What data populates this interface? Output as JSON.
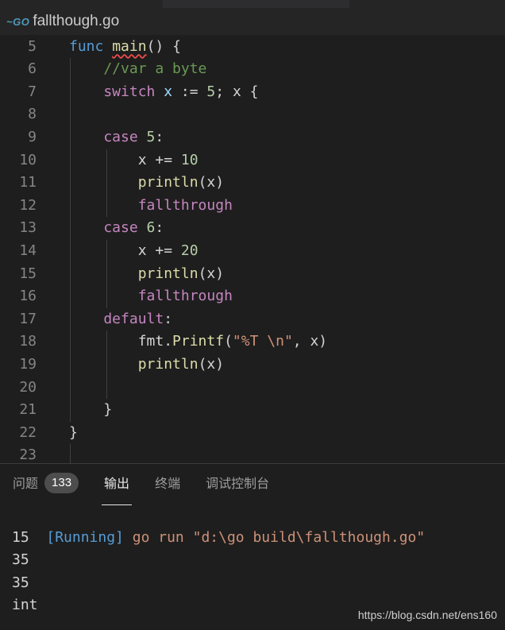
{
  "tab": {
    "icon": "go-file-icon",
    "icon_text": "~GO",
    "file_name": "fallthough.go"
  },
  "editor": {
    "lines": [
      {
        "n": "5",
        "t": [
          [
            "kw",
            "func"
          ],
          [
            "",
            ""
          ],
          [
            "fn sq",
            "main"
          ],
          [
            "",
            "() {"
          ]
        ]
      },
      {
        "n": "6",
        "t": [
          [
            "cm",
            "    //var a byte"
          ]
        ]
      },
      {
        "n": "7",
        "t": [
          [
            "ctl",
            "    switch"
          ],
          [
            "var",
            " x"
          ],
          [
            "",
            " := "
          ],
          [
            "num",
            "5"
          ],
          [
            "",
            "; x {"
          ]
        ]
      },
      {
        "n": "8",
        "t": []
      },
      {
        "n": "9",
        "t": [
          [
            "ctl",
            "    case"
          ],
          [
            "num",
            " 5"
          ],
          [
            "",
            ":"
          ]
        ]
      },
      {
        "n": "10",
        "t": [
          [
            "",
            "        x += "
          ],
          [
            "num",
            "10"
          ]
        ]
      },
      {
        "n": "11",
        "t": [
          [
            "fn",
            "        println"
          ],
          [
            "",
            "(x)"
          ]
        ]
      },
      {
        "n": "12",
        "t": [
          [
            "ctl",
            "        fallthrough"
          ]
        ]
      },
      {
        "n": "13",
        "t": [
          [
            "ctl",
            "    case"
          ],
          [
            "num",
            " 6"
          ],
          [
            "",
            ":"
          ]
        ]
      },
      {
        "n": "14",
        "t": [
          [
            "",
            "        x += "
          ],
          [
            "num",
            "20"
          ]
        ]
      },
      {
        "n": "15",
        "t": [
          [
            "fn",
            "        println"
          ],
          [
            "",
            "(x)"
          ]
        ]
      },
      {
        "n": "16",
        "t": [
          [
            "ctl",
            "        fallthrough"
          ]
        ]
      },
      {
        "n": "17",
        "t": [
          [
            "ctl",
            "    default"
          ],
          [
            "",
            ":"
          ]
        ]
      },
      {
        "n": "18",
        "t": [
          [
            "",
            "        fmt."
          ],
          [
            "fn",
            "Printf"
          ],
          [
            "",
            "("
          ],
          [
            "str",
            "\"%T \\n\""
          ],
          [
            "",
            ", x)"
          ]
        ]
      },
      {
        "n": "19",
        "t": [
          [
            "fn",
            "        println"
          ],
          [
            "",
            "(x)"
          ]
        ]
      },
      {
        "n": "20",
        "t": []
      },
      {
        "n": "21",
        "t": [
          [
            "",
            "    }"
          ]
        ]
      },
      {
        "n": "22",
        "t": [
          [
            "",
            "}"
          ]
        ]
      },
      {
        "n": "23",
        "t": []
      }
    ]
  },
  "panel": {
    "tabs": [
      {
        "label": "问题",
        "badge": "133",
        "active": false
      },
      {
        "label": "输出",
        "active": true
      },
      {
        "label": "终端",
        "active": false
      },
      {
        "label": "调试控制台",
        "active": false
      }
    ],
    "output": {
      "running_tag": "[Running]",
      "command": "go run \"d:\\go build\\fallthough.go\"",
      "lines": [
        "15",
        "35",
        "35",
        "int"
      ]
    }
  },
  "watermark": "https://blog.csdn.net/ens160"
}
